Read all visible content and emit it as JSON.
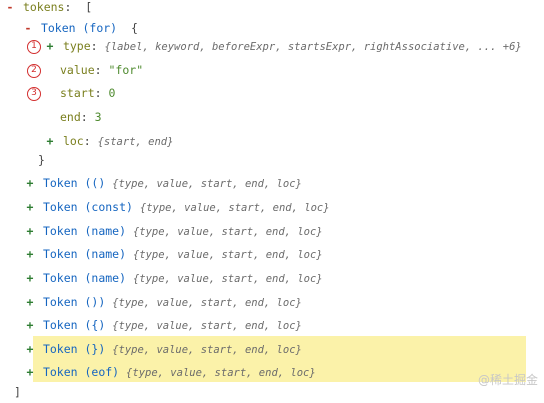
{
  "tree": {
    "root_key": "tokens",
    "open_bracket": "[",
    "close_bracket": "]",
    "first_token": {
      "name": "Token (for)",
      "open_brace": "{",
      "close_brace": "}",
      "type_key": "type",
      "type_summary": "{label, keyword, beforeExpr, startsExpr, rightAssociative, ... +6}",
      "value_key": "value",
      "value_val": "\"for\"",
      "start_key": "start",
      "start_val": "0",
      "end_key": "end",
      "end_val": "3",
      "loc_key": "loc",
      "loc_summary": "{start, end}"
    },
    "collapsed_summary": "{type, value, start, end, loc}",
    "collapsed_tokens": [
      "Token (()",
      "Token (const)",
      "Token (name)",
      "Token (name)",
      "Token (name)",
      "Token ())",
      "Token ({)",
      "Token (})",
      "Token (eof)"
    ]
  },
  "markers": [
    "1",
    "2",
    "3"
  ],
  "watermark": "@稀土掘金",
  "colors": {
    "highlight": "#fbf2a9",
    "marker": "#d32f2f",
    "collapse_toggle": "#c0392b",
    "expand_toggle": "#2e7d32",
    "key": "#7a7f1e",
    "token_name": "#1565c0"
  },
  "icons": {
    "collapse": "minus-toggle-icon",
    "expand": "plus-toggle-icon"
  }
}
